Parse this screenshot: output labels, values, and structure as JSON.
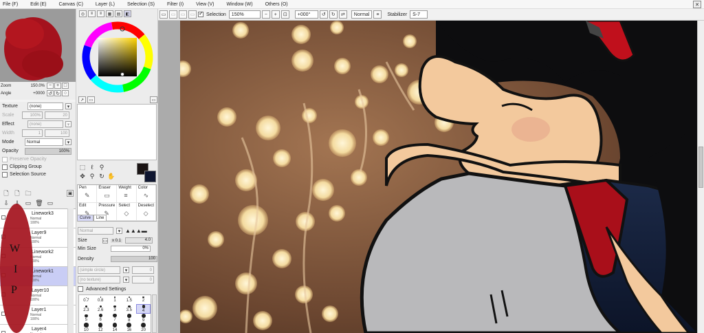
{
  "menu": [
    "File (F)",
    "Edit (E)",
    "Canvas (C)",
    "Layer (L)",
    "Selection (S)",
    "Filter (I)",
    "View (V)",
    "Window (W)",
    "Others (O)"
  ],
  "toolbar": {
    "selection_label": "Selection",
    "zoom": "150%",
    "rotation": "+000°",
    "blend": "Normal",
    "stabilizer_label": "Stabilizer",
    "stabilizer_value": "S-7"
  },
  "navigator": {
    "zoom_label": "Zoom",
    "zoom_value": "150.0%",
    "angle_label": "Angle",
    "angle_value": "+0000"
  },
  "layer_props": {
    "texture_label": "Texture",
    "texture_value": "(none)",
    "scale_label": "Scale",
    "scale_value": "100%",
    "scale_num": "20",
    "effect_label": "Effect",
    "effect_value": "(none)",
    "width_label": "Width",
    "width_value": "1",
    "width_num": "100",
    "mode_label": "Mode",
    "mode_value": "Normal",
    "opacity_label": "Opacity",
    "opacity_value": "100%",
    "preserve_opacity": "Preserve Opacity",
    "clipping_group": "Clipping Group",
    "selection_source": "Selection Source"
  },
  "layers": [
    {
      "name": "Linework3",
      "mode": "Normal",
      "pct": "100%",
      "selected": false
    },
    {
      "name": "Layer9",
      "mode": "Normal",
      "pct": "100%",
      "selected": false
    },
    {
      "name": "Linework2",
      "mode": "Normal",
      "pct": "100%",
      "selected": false
    },
    {
      "name": "Linework1",
      "mode": "Normal",
      "pct": "100%",
      "selected": true
    },
    {
      "name": "Layer10",
      "mode": "Normal",
      "pct": "100%",
      "selected": false
    },
    {
      "name": "Layer1",
      "mode": "Normal",
      "pct": "100%",
      "selected": false
    },
    {
      "name": "Layer4",
      "mode": "Normal",
      "pct": "100%",
      "selected": false
    }
  ],
  "brushes": [
    {
      "label": "Pen",
      "icon": "✎"
    },
    {
      "label": "Eraser",
      "icon": "▭"
    },
    {
      "label": "Weight",
      "icon": "≡"
    },
    {
      "label": "Color",
      "icon": "∿"
    },
    {
      "label": "Edit",
      "icon": "✎"
    },
    {
      "label": "Pressure",
      "icon": "✎"
    },
    {
      "label": "Select",
      "icon": "◇"
    },
    {
      "label": "Deselect",
      "icon": "◇"
    }
  ],
  "brush_tabs": [
    "Curve",
    "Line"
  ],
  "brush_settings": {
    "mode_value": "Normal",
    "size_label": "Size",
    "size_mult": "x 0.1",
    "size_value": "4.0",
    "min_size_label": "Min Size",
    "min_size_value": "0%",
    "density_label": "Density",
    "density_value": "100",
    "simple_order": "(simple circle)",
    "simple_num": "0",
    "no_texture": "(no texture)",
    "no_texture_num": "0",
    "advanced": "Advanced Settings"
  },
  "size_table": [
    "0.7",
    "0.8",
    "1",
    "1.5",
    "2",
    "2.3",
    "2.6",
    "3",
    "3.5",
    "4",
    "5",
    "6",
    "7",
    "8",
    "9",
    "10",
    "12",
    "14",
    "16",
    "20"
  ],
  "size_selected_index": 9,
  "watermark": "WIP",
  "colors": {
    "accent": "#c9cdf5",
    "fg": "#1a1414",
    "bg": "#ffffff"
  }
}
